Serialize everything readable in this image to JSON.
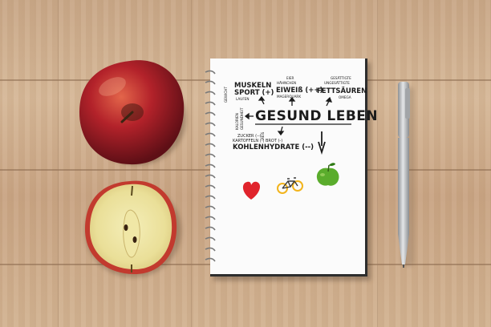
{
  "notebook": {
    "title": "GESUND LEBEN",
    "labels": {
      "muskeln": "MUSKELN",
      "sport": "SPORT (+)",
      "laufen": "LAUFEN",
      "eiweiss": "EIWEIß (++)",
      "eiweiss_top": "EIER",
      "eiweiss_top2": "HÄHNCHEN",
      "magerquark": "MAGERQUARK",
      "fettsaeuren": "FETTSÄUREN",
      "fett_top1": "GESÄTTIGTE",
      "fett_top2": "UNGESÄTTIGTE",
      "fett_bottom": "OMEGA",
      "kohlenhydrate": "KOHLENHYDRATE (--)",
      "zucker": "ZUCKER (--)",
      "kartoffeln": "KARTOFFELN (-)",
      "brot": "BROT (-)",
      "reis": "REIS",
      "gewicht": "GEWICHT",
      "kalorien": "KALORIEN",
      "gesundheit": "GESUNDHEIT"
    },
    "icons": [
      "heart-icon",
      "bicycle-icon",
      "apple-icon"
    ]
  },
  "colors": {
    "heart": "#e0242c",
    "apple_icon": "#5aac2c",
    "bike_wheel": "#f2b41c",
    "bike_frame": "#3a3a3a",
    "apple_red": "#b3222a",
    "notebook_page": "#fbfbfb",
    "pen_body": "#b9bcbf"
  }
}
